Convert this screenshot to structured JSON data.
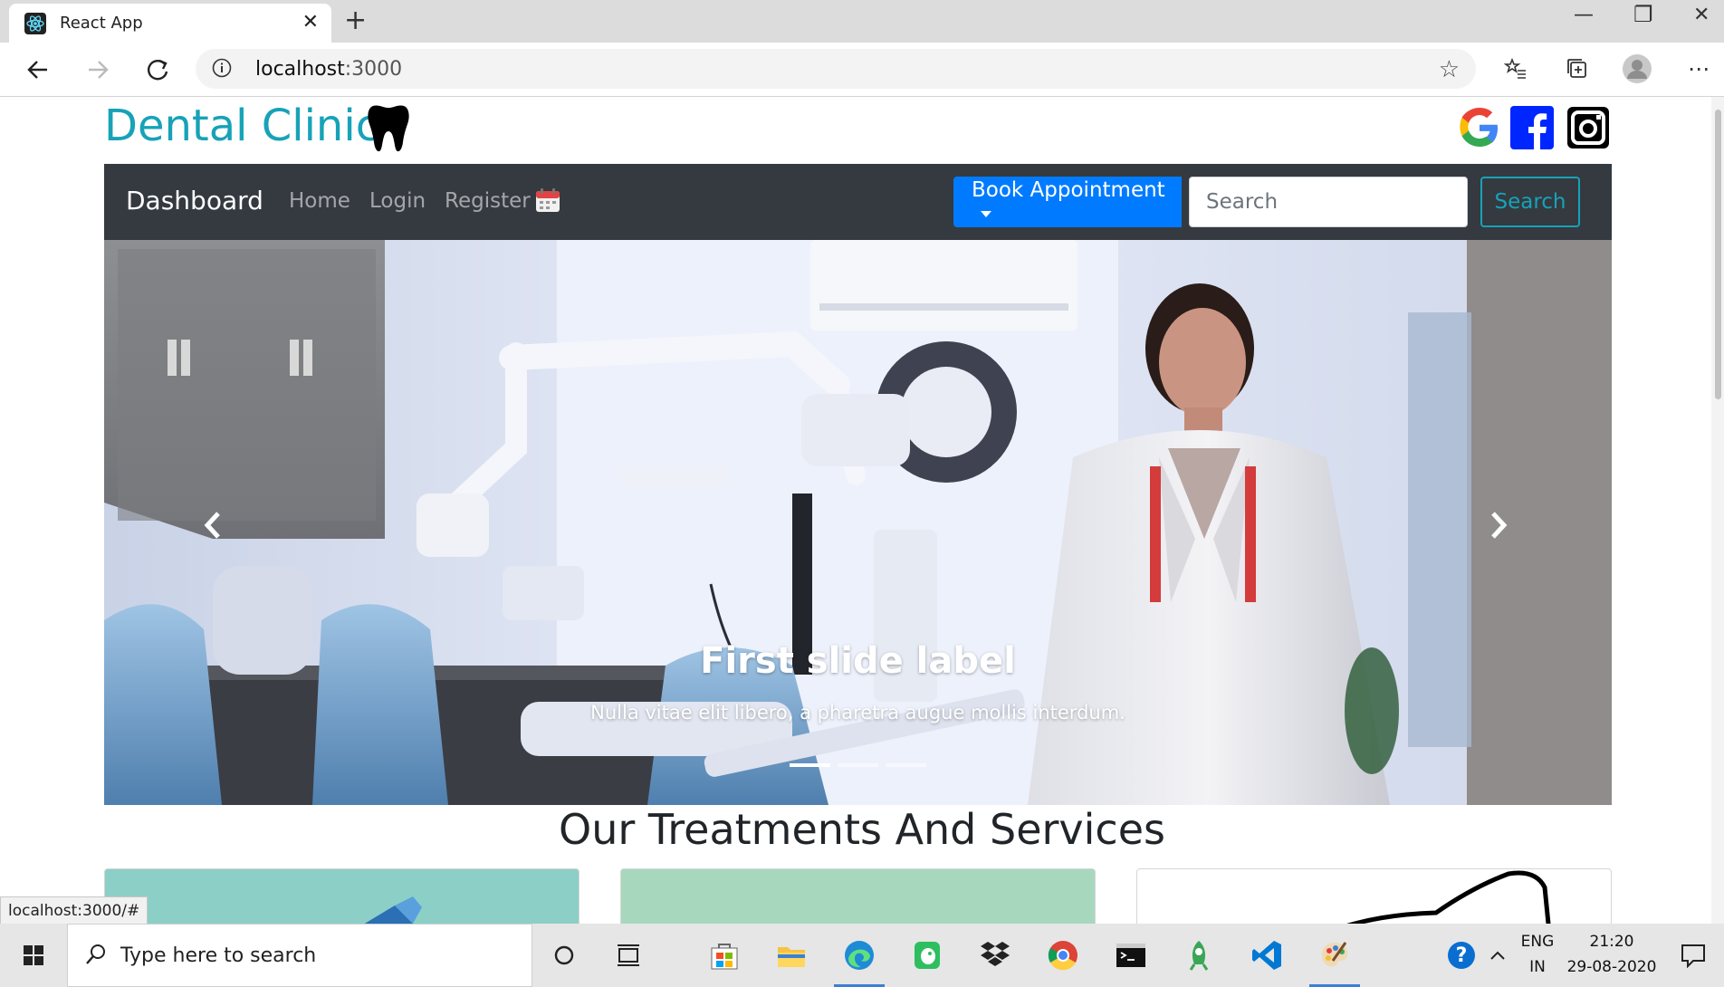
{
  "browser": {
    "tab_title": "React App",
    "url_host": "localhost",
    "url_port": ":3000",
    "status_url": "localhost:3000/#"
  },
  "page": {
    "brand": "Dental Clinic",
    "nav": {
      "dashboard": "Dashboard",
      "home": "Home",
      "login": "Login",
      "register": "Register",
      "book_appointment": "Book Appointment",
      "search_placeholder": "Search",
      "search_button": "Search"
    },
    "carousel": {
      "caption_title": "First slide label",
      "caption_text": "Nulla vitae elit libero, a pharetra augue mollis interdum.",
      "slide_count": 3,
      "active_slide": 1
    },
    "section_title": "Our Treatments And Services",
    "social_icons": [
      "google-icon",
      "facebook-icon",
      "instagram-icon"
    ]
  },
  "taskbar": {
    "search_placeholder": "Type here to search",
    "lang_line1": "ENG",
    "lang_line2": "IN",
    "time": "21:20",
    "date": "29-08-2020"
  },
  "colors": {
    "brand": "#17a2b8",
    "navbar": "#343a40",
    "primary": "#007bff"
  }
}
